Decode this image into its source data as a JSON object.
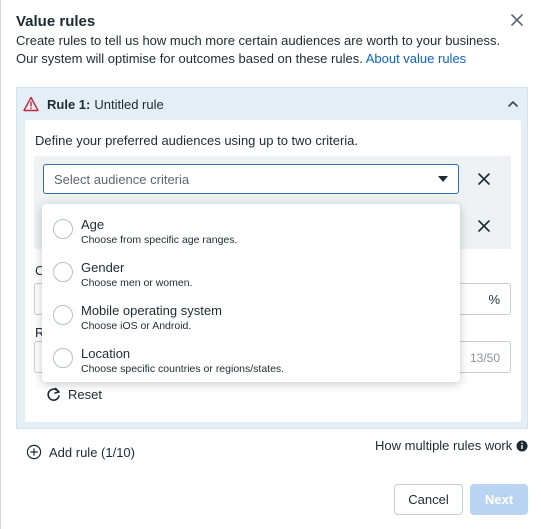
{
  "dialog": {
    "title": "Value rules",
    "description_line1": "Create rules to tell us how much more certain audiences are worth to your business.",
    "description_line2": "Our system will optimise for outcomes based on these rules.",
    "about_link": "About value rules"
  },
  "rule": {
    "prefix": "Rule 1:",
    "name": "Untitled rule",
    "define_label": "Define your preferred audiences using up to two criteria.",
    "select_placeholder": "Select audience criteria",
    "partial_label_1": "C",
    "percent_suffix": "%",
    "partial_label_2": "R",
    "char_count": "13/50",
    "reset_label": "Reset"
  },
  "dropdown": {
    "options": [
      {
        "name": "Age",
        "sub": "Choose from specific age ranges."
      },
      {
        "name": "Gender",
        "sub": "Choose men or women."
      },
      {
        "name": "Mobile operating system",
        "sub": "Choose iOS or Android."
      },
      {
        "name": "Location",
        "sub": "Choose specific countries or regions/states."
      }
    ]
  },
  "footer": {
    "add_rule": "Add rule (1/10)",
    "how_link": "How multiple rules work",
    "cancel": "Cancel",
    "next": "Next"
  },
  "colors": {
    "accent": "#0a64c8",
    "panel_bg": "#e3eef6",
    "warning": "#c5283d",
    "next_disabled": "#b9d4f3"
  },
  "icons": [
    "close-icon",
    "warning-icon",
    "chevron-up-icon",
    "caret-down-icon",
    "reset-icon",
    "plus-circle-icon",
    "info-icon"
  ]
}
